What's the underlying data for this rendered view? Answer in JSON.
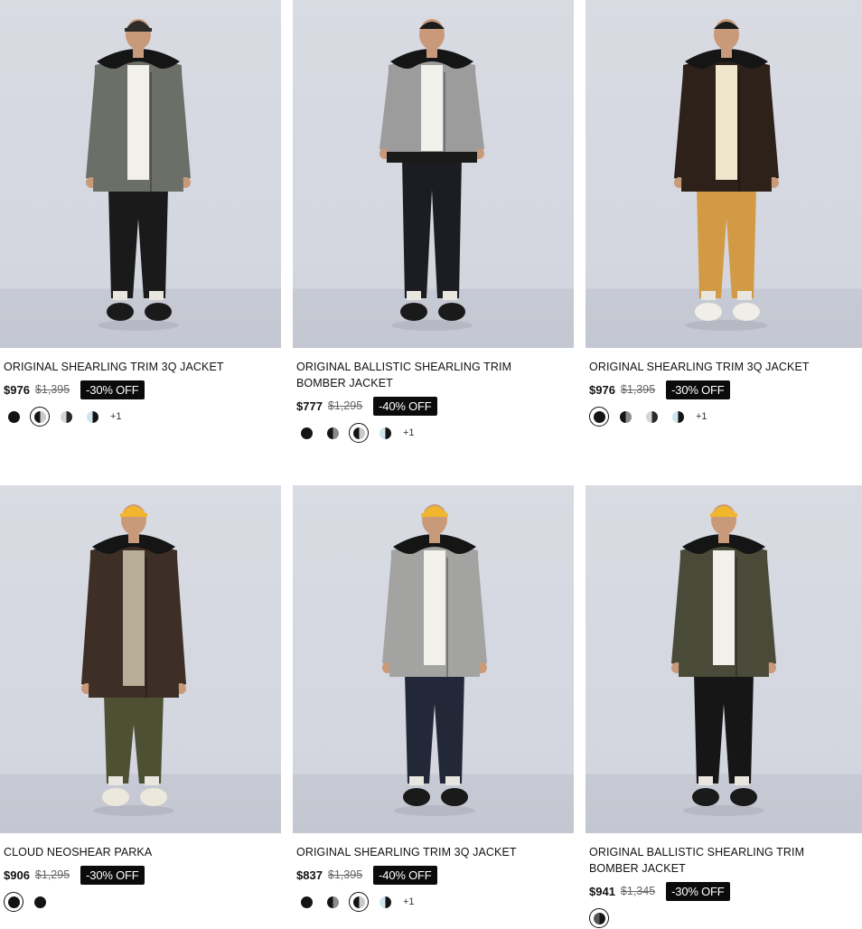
{
  "products": [
    {
      "name": "ORIGINAL SHEARLING TRIM 3Q JACKET",
      "price": "$976",
      "original_price": "$1,395",
      "discount": "-30% OFF",
      "swatches": [
        "full-black",
        "half-black-selected",
        "half-grey",
        "half-lightblue"
      ],
      "more": "+1",
      "colors": {
        "jacket": "#6b6f68",
        "pants": "#1a1a1a",
        "collar": "#151515",
        "inner": "#f2f0ea",
        "shoes": "#1a1a1a",
        "hat": "#2e2c2a"
      }
    },
    {
      "name": "ORIGINAL BALLISTIC SHEARLING TRIM BOMBER JACKET",
      "price": "$777",
      "original_price": "$1,295",
      "discount": "-40% OFF",
      "swatches": [
        "full-black",
        "half-dark",
        "half-black-selected",
        "half-lightblue"
      ],
      "more": "+1",
      "colors": {
        "jacket": "#9c9c9c",
        "pants": "#1c1d22",
        "collar": "#151515",
        "inner": "#f2f0ea",
        "shoes": "#1a1a1a",
        "hat": ""
      }
    },
    {
      "name": "ORIGINAL SHEARLING TRIM 3Q JACKET",
      "price": "$976",
      "original_price": "$1,395",
      "discount": "-30% OFF",
      "swatches": [
        "full-black-selected",
        "half-dark",
        "half-grey",
        "half-lightblue"
      ],
      "more": "+1",
      "colors": {
        "jacket": "#2d2119",
        "pants": "#d29a45",
        "collar": "#151515",
        "inner": "#f0e6cc",
        "shoes": "#efeee8",
        "hat": ""
      }
    },
    {
      "name": "CLOUD NEOSHEAR PARKA",
      "price": "$906",
      "original_price": "$1,295",
      "discount": "-30% OFF",
      "swatches": [
        "full-black-selected",
        "full-black"
      ],
      "more": "",
      "colors": {
        "jacket": "#3e2f26",
        "pants": "#4e5033",
        "collar": "#151515",
        "inner": "#b8ad97",
        "shoes": "#ece8dc",
        "hat": "#f2b62e"
      }
    },
    {
      "name": "ORIGINAL SHEARLING TRIM 3Q JACKET",
      "price": "$837",
      "original_price": "$1,395",
      "discount": "-40% OFF",
      "swatches": [
        "full-black",
        "half-dark",
        "half-black-selected",
        "half-lightblue"
      ],
      "more": "+1",
      "colors": {
        "jacket": "#a3a3a1",
        "pants": "#232838",
        "collar": "#151515",
        "inner": "#f2f0ea",
        "shoes": "#1a1a1a",
        "hat": "#f2b62e"
      }
    },
    {
      "name": "ORIGINAL BALLISTIC SHEARLING TRIM BOMBER JACKET",
      "price": "$941",
      "original_price": "$1,345",
      "discount": "-30% OFF",
      "swatches": [
        "half-camo-selected"
      ],
      "more": "",
      "colors": {
        "jacket": "#4a4a38",
        "pants": "#161616",
        "collar": "#151515",
        "inner": "#f2f0ea",
        "shoes": "#1a1a1a",
        "hat": "#f2b62e"
      }
    }
  ]
}
